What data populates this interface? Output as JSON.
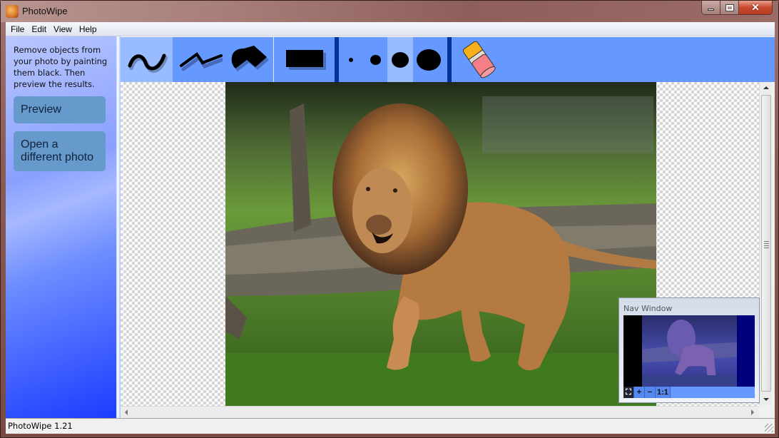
{
  "window": {
    "title": "PhotoWipe",
    "controls": {
      "minimize": "minimize",
      "maximize": "maximize",
      "close": "close"
    }
  },
  "menu": {
    "items": [
      {
        "label": "File"
      },
      {
        "label": "Edit"
      },
      {
        "label": "View"
      },
      {
        "label": "Help"
      }
    ]
  },
  "sidebar": {
    "instructions": "Remove objects from your photo by painting them black. Then preview the results.",
    "preview_label": "Preview",
    "open_label": "Open a different photo"
  },
  "toolbar": {
    "tools": [
      {
        "name": "freehand-brush",
        "icon": "freehand-curve-icon",
        "selected": true
      },
      {
        "name": "line-tool",
        "icon": "zigzag-line-icon",
        "selected": false
      },
      {
        "name": "polygon-tool",
        "icon": "polygon-icon",
        "selected": false
      },
      {
        "name": "rectangle-tool",
        "icon": "rectangle-icon",
        "selected": false
      }
    ],
    "brush_sizes": [
      {
        "name": "brush-size-1",
        "selected": false
      },
      {
        "name": "brush-size-2",
        "selected": false
      },
      {
        "name": "brush-size-3",
        "selected": true
      },
      {
        "name": "brush-size-4",
        "selected": false
      }
    ],
    "eraser": {
      "name": "eraser-tool",
      "icon": "eraser-icon"
    },
    "colors": {
      "bar": "#6699ff",
      "selected": "#99bbff",
      "separator": "#003399"
    }
  },
  "canvas": {
    "image_subject": "Lion leaping over a fallen log on grass"
  },
  "nav_window": {
    "title": "Nav Window",
    "buttons": [
      {
        "label": "⛶",
        "name": "fit-button"
      },
      {
        "label": "+",
        "name": "zoom-in-button"
      },
      {
        "label": "−",
        "name": "zoom-out-button"
      },
      {
        "label": "1:1",
        "name": "actual-size-button"
      }
    ]
  },
  "status": {
    "text": "PhotoWipe 1.21"
  }
}
